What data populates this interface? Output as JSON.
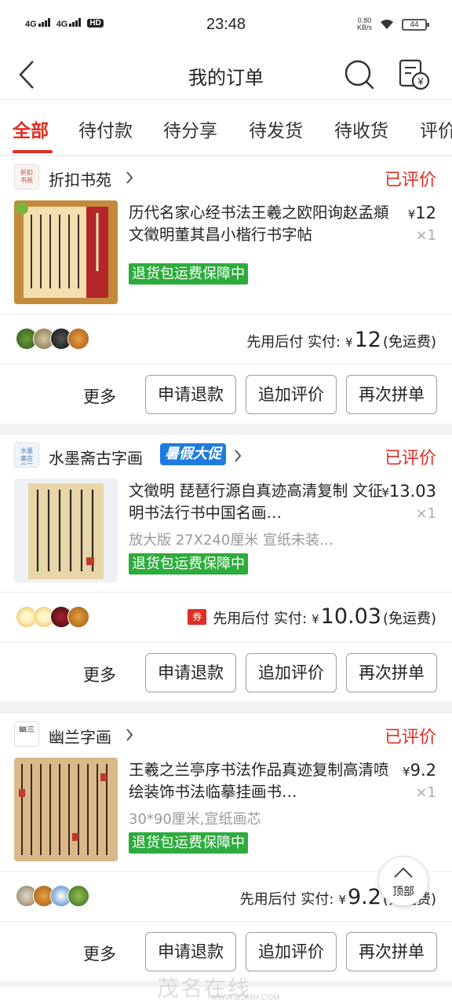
{
  "status_bar": {
    "sim1": "4G",
    "sim2": "4G",
    "hd": "HD",
    "time": "23:48",
    "net_speed_value": "0.80",
    "net_speed_unit": "KB/s",
    "battery": "44"
  },
  "header": {
    "title": "我的订单",
    "back_icon": "back-chevron-icon",
    "search_icon": "search-icon",
    "bill_icon": "bill-yen-icon"
  },
  "tabs": [
    {
      "label": "全部",
      "active": true
    },
    {
      "label": "待付款",
      "active": false
    },
    {
      "label": "待分享",
      "active": false
    },
    {
      "label": "待发货",
      "active": false
    },
    {
      "label": "待收货",
      "active": false
    },
    {
      "label": "评价",
      "active": false
    }
  ],
  "orders": [
    {
      "shop": "折扣书苑",
      "shop_logo_text": "折扣书苑",
      "promo": "",
      "status": "已评价",
      "title": "历代名家心经书法王羲之欧阳询赵孟頫文徵明董其昌小楷行书字帖",
      "spec": "",
      "guarantee": "退货包运费保障中",
      "price": "12",
      "qty": "×1",
      "pay_label": "先用后付",
      "paid_label": "实付:",
      "paid_amount": "12",
      "shipping": "(免运费)",
      "coupon": ""
    },
    {
      "shop": "水墨斋古字画",
      "shop_logo_text": "水墨斋古字画",
      "promo": "暑假大促",
      "status": "已评价",
      "title": "文徵明 琵琶行源自真迹高清复制 文征明书法行书中国名画…",
      "spec": "放大版 27X240厘米 宣纸未装…",
      "guarantee": "退货包运费保障中",
      "price": "13.03",
      "qty": "×1",
      "pay_label": "先用后付",
      "paid_label": "实付:",
      "paid_amount": "10.03",
      "shipping": "(免运费)",
      "coupon": "券"
    },
    {
      "shop": "幽兰字画",
      "shop_logo_text": "幽兰",
      "promo": "",
      "status": "已评价",
      "title": "王羲之兰亭序书法作品真迹复制高清喷绘装饰书法临摹挂画书…",
      "spec": "30*90厘米,宣纸画芯",
      "guarantee": "退货包运费保障中",
      "price": "9.2",
      "qty": "×1",
      "pay_label": "先用后付",
      "paid_label": "实付:",
      "paid_amount": "9.2",
      "shipping": "(免运费)",
      "coupon": ""
    }
  ],
  "actions": {
    "more": "更多",
    "refund": "申请退款",
    "add_review": "追加评价",
    "rebuy": "再次拼单"
  },
  "fab": {
    "label": "顶部"
  },
  "currency": "¥",
  "watermark": {
    "text": "茂名在线",
    "url": "WWW.GDMM.COM"
  },
  "colors": {
    "accent": "#e02e24",
    "guarantee": "#2dab3c",
    "promo": "#1e7ce0"
  }
}
